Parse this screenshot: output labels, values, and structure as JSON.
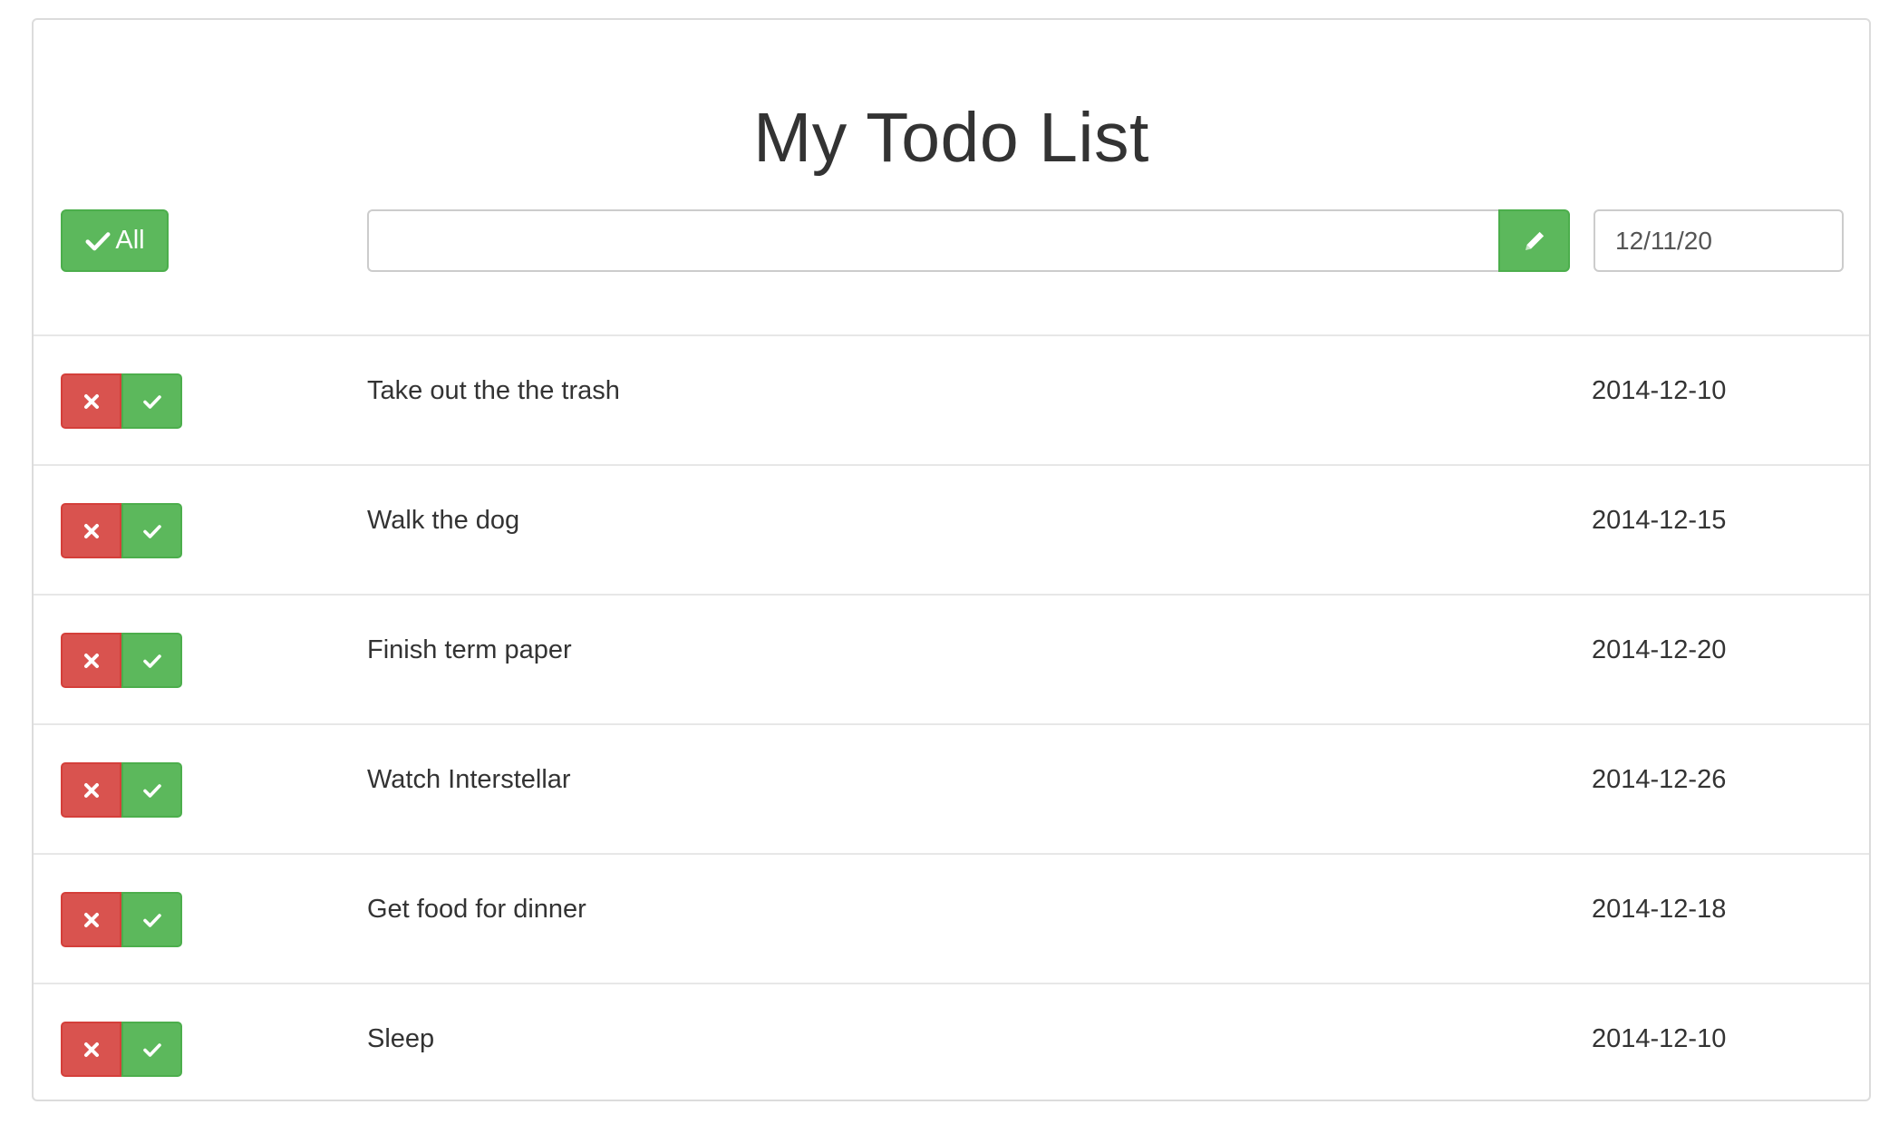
{
  "header": {
    "title": "My Todo List"
  },
  "toolbar": {
    "all_label": "All",
    "todo_input_value": "",
    "date_value": "12/11/20"
  },
  "todos": [
    {
      "text": "Take out the the trash",
      "date": "2014-12-10"
    },
    {
      "text": "Walk the dog",
      "date": "2014-12-15"
    },
    {
      "text": "Finish term paper",
      "date": "2014-12-20"
    },
    {
      "text": "Watch Interstellar",
      "date": "2014-12-26"
    },
    {
      "text": "Get food for dinner",
      "date": "2014-12-18"
    },
    {
      "text": "Sleep",
      "date": "2014-12-10"
    }
  ],
  "icons": {
    "all": "check-icon",
    "add": "pencil-icon",
    "delete": "close-icon",
    "done": "check-icon"
  },
  "colors": {
    "success": "#5cb85c",
    "danger": "#d9534f"
  }
}
